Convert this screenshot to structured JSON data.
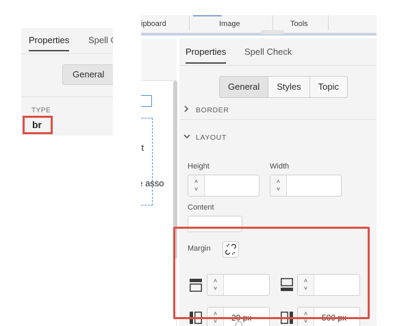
{
  "left_crop": {
    "tabs": {
      "properties": "Properties",
      "spell_check": "Spell C"
    },
    "general_button": "General",
    "type_label": "TYPE",
    "type_value": "br"
  },
  "ribbon": {
    "groups": {
      "clipboard": "ipboard",
      "image": "Image",
      "tools": "Tools"
    }
  },
  "document": {
    "fragment_1": "xt",
    "fragment_2": "ne asso"
  },
  "panel": {
    "tabs": {
      "properties": "Properties",
      "spell_check": "Spell Check"
    },
    "segments": [
      {
        "label": "General",
        "selected": true
      },
      {
        "label": "Styles",
        "selected": false
      },
      {
        "label": "Topic",
        "selected": false
      }
    ],
    "sections": {
      "border": {
        "label": "BORDER",
        "expanded": false
      },
      "layout": {
        "label": "LAYOUT",
        "expanded": true
      }
    },
    "layout": {
      "height_label": "Height",
      "height_value": "",
      "width_label": "Width",
      "width_value": "",
      "content_label": "Content",
      "content_value": "",
      "margin_label": "Margin",
      "margin_top": "",
      "margin_bottom": "",
      "margin_left": "20 px",
      "margin_right": "500 px"
    }
  },
  "icons": {
    "link": "unlink-icon",
    "section_collapsed": "chevron-right-icon",
    "section_expanded": "chevron-down-icon",
    "margin_top": "margin-top-icon",
    "margin_bottom": "margin-bottom-icon",
    "margin_left": "margin-left-icon",
    "margin_right": "margin-right-icon"
  },
  "colors": {
    "highlight": "#dd5044",
    "panel_bg": "#f4f4f4",
    "selection": "#4d8fdb"
  }
}
